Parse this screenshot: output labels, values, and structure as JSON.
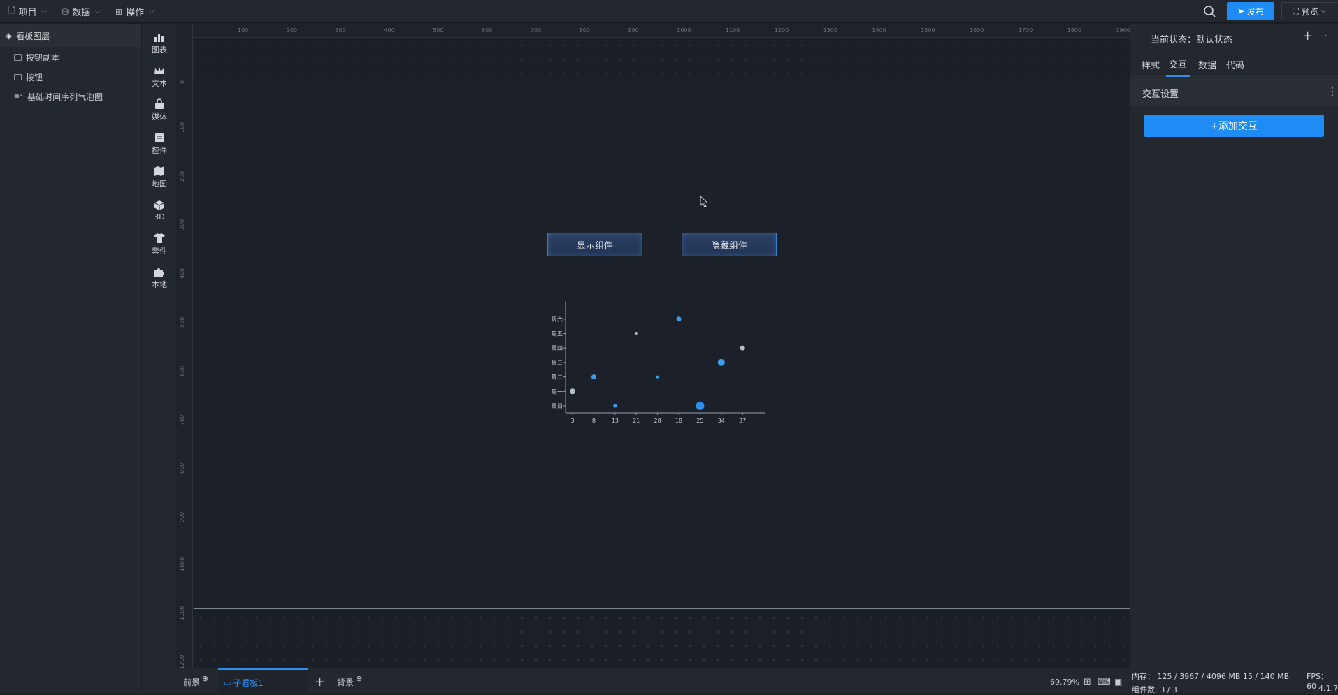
{
  "topbar": {
    "menus": [
      {
        "label": "项目",
        "icon": "file-icon"
      },
      {
        "label": "数据",
        "icon": "database-icon"
      },
      {
        "label": "操作",
        "icon": "grid-icon"
      }
    ],
    "publish_label": "发布",
    "preview_label": "预览"
  },
  "layers": {
    "title": "看板图层",
    "items": [
      {
        "label": "按钮副本",
        "icon": "image-icon"
      },
      {
        "label": "按钮",
        "icon": "image-icon"
      },
      {
        "label": "基础时间序列气泡图",
        "icon": "bubble-chart-icon"
      }
    ]
  },
  "tools": [
    {
      "label": "图表",
      "icon": "bar-chart-icon"
    },
    {
      "label": "文本",
      "icon": "crown-icon"
    },
    {
      "label": "媒体",
      "icon": "bag-icon"
    },
    {
      "label": "控件",
      "icon": "widget-icon"
    },
    {
      "label": "地图",
      "icon": "map-icon"
    },
    {
      "label": "3D",
      "icon": "cube-icon"
    },
    {
      "label": "套件",
      "icon": "shirt-icon"
    },
    {
      "label": "本地",
      "icon": "puzzle-icon"
    }
  ],
  "ruler": {
    "h_ticks": [
      "100",
      "200",
      "300",
      "400",
      "500",
      "600",
      "700",
      "800",
      "900",
      "1000",
      "1100",
      "1200",
      "1300",
      "1400",
      "1500",
      "1600",
      "1700",
      "1800",
      "1900"
    ],
    "v_ticks": [
      "0",
      "100",
      "200",
      "300",
      "400",
      "500",
      "600",
      "700",
      "800",
      "900",
      "1000",
      "1100",
      "1200"
    ]
  },
  "canvas": {
    "buttons": [
      "显示组件",
      "隐藏组件"
    ]
  },
  "chart_data": {
    "type": "scatter",
    "categories_y": [
      "周日",
      "周一",
      "周二",
      "周三",
      "周四",
      "周五",
      "周六"
    ],
    "x_ticks": [
      "3",
      "8",
      "13",
      "21",
      "28",
      "18",
      "25",
      "34",
      "37"
    ],
    "points": [
      {
        "x": "3",
        "y": "周一",
        "size": 4,
        "color": "#b7c0c8"
      },
      {
        "x": "8",
        "y": "周二",
        "size": 3.5,
        "color": "#3a9ee8"
      },
      {
        "x": "13",
        "y": "周日",
        "size": 2.5,
        "color": "#3a9ee8"
      },
      {
        "x": "21",
        "y": "周五",
        "size": 1.5,
        "color": "#b7c0c8"
      },
      {
        "x": "28",
        "y": "周二",
        "size": 2,
        "color": "#3a9ee8"
      },
      {
        "x": "18",
        "y": "周六",
        "size": 3.5,
        "color": "#3a9ee8"
      },
      {
        "x": "25",
        "y": "周日",
        "size": 6,
        "color": "#2f8ee8"
      },
      {
        "x": "34",
        "y": "周三",
        "size": 5,
        "color": "#3a9ee8"
      },
      {
        "x": "37",
        "y": "周四",
        "size": 3.5,
        "color": "#b7c0c8"
      }
    ],
    "title": "",
    "xlabel": "",
    "ylabel": ""
  },
  "bottom": {
    "tab_front": "前景",
    "tab_sub": "子看板1",
    "tab_back": "背景",
    "zoom": "69.79%"
  },
  "rpanel": {
    "state_label": "当前状态：默认状态",
    "tabs": [
      "样式",
      "交互",
      "数据",
      "代码"
    ],
    "active_tab": "交互",
    "section_title": "交互设置",
    "add_label": "+添加交互"
  },
  "status": {
    "memory": "内存： 125 / 3967 / 4096 MB  15 / 140 MB",
    "fps": "FPS： 60",
    "components": "组件数: 3 / 3",
    "version": "4.1.7"
  },
  "colors": {
    "accent": "#1f8cf5",
    "bg": "#1b1f26",
    "panel": "#23272e"
  }
}
